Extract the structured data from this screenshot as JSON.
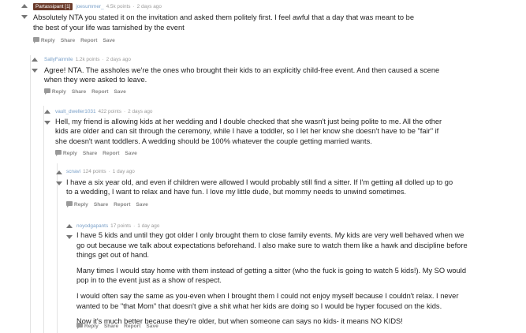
{
  "comments": [
    {
      "flair": "Partassipant [1]",
      "author": "joesummer_",
      "points": "4.5k points",
      "time": "2 days ago",
      "paragraphs": [
        "Absolutely NTA you stated it on the invitation and asked them politely first. I feel awful that a day that was meant to be",
        "the best of your life was tarnished by the event"
      ]
    },
    {
      "author": "SallyFairmile",
      "points": "1.2k points",
      "time": "2 days ago",
      "paragraphs": [
        "Agree! NTA. The assholes we're the ones who brought their kids to an explicitly child-free event. And then caused a scene",
        "when they were asked to leave."
      ]
    },
    {
      "author": "vault_dweller1031",
      "points": "422 points",
      "time": "2 days ago",
      "paragraphs": [
        "Hell, my friend is allowing kids at her wedding and I double checked that she wasn't just being polite to me. All the other",
        "kids are older and can sit through the ceremony, while I have a toddler, so I let her know she doesn't have to be \"fair\" if",
        "she doesn't want toddlers. A wedding should be 100% whatever the couple getting married wants."
      ]
    },
    {
      "author": "scnavi",
      "points": "124 points",
      "time": "1 day ago",
      "paragraphs": [
        "I have a six year old, and even if children were allowed I would probably still find a sitter. If I'm getting all dolled up to go",
        "to a wedding, I want to relax and have fun. I love my little dude, but mommy needs to unwind sometimes."
      ]
    },
    {
      "author": "noyodgapants",
      "points": "17 points",
      "time": "1 day ago",
      "paragraphs": [
        "I have 5 kids and until they got older I only brought them to close family events. My kids are very well behaved when we",
        "go out because we talk about expectations beforehand. I also make sure to watch them like a hawk and discipline before",
        "things get out of hand.",
        "Many times I would stay home with them instead of getting a sitter (who the fuck is going to watch 5 kids!). My SO would",
        "pop in to the event just as a show of respect.",
        "I would often say the same as you-even when I brought them I could not enjoy myself because I couldn't relax. I never",
        "wanted to be \"that Mom\" that doesn't give a shit what her kids are doing so I would be hyper focused on the kids.",
        "Now it's much better because they're older, but when someone can says no kids- it means NO KIDS!"
      ]
    }
  ],
  "actions": {
    "reply": "Reply",
    "share": "Share",
    "report": "Report",
    "save": "Save"
  }
}
